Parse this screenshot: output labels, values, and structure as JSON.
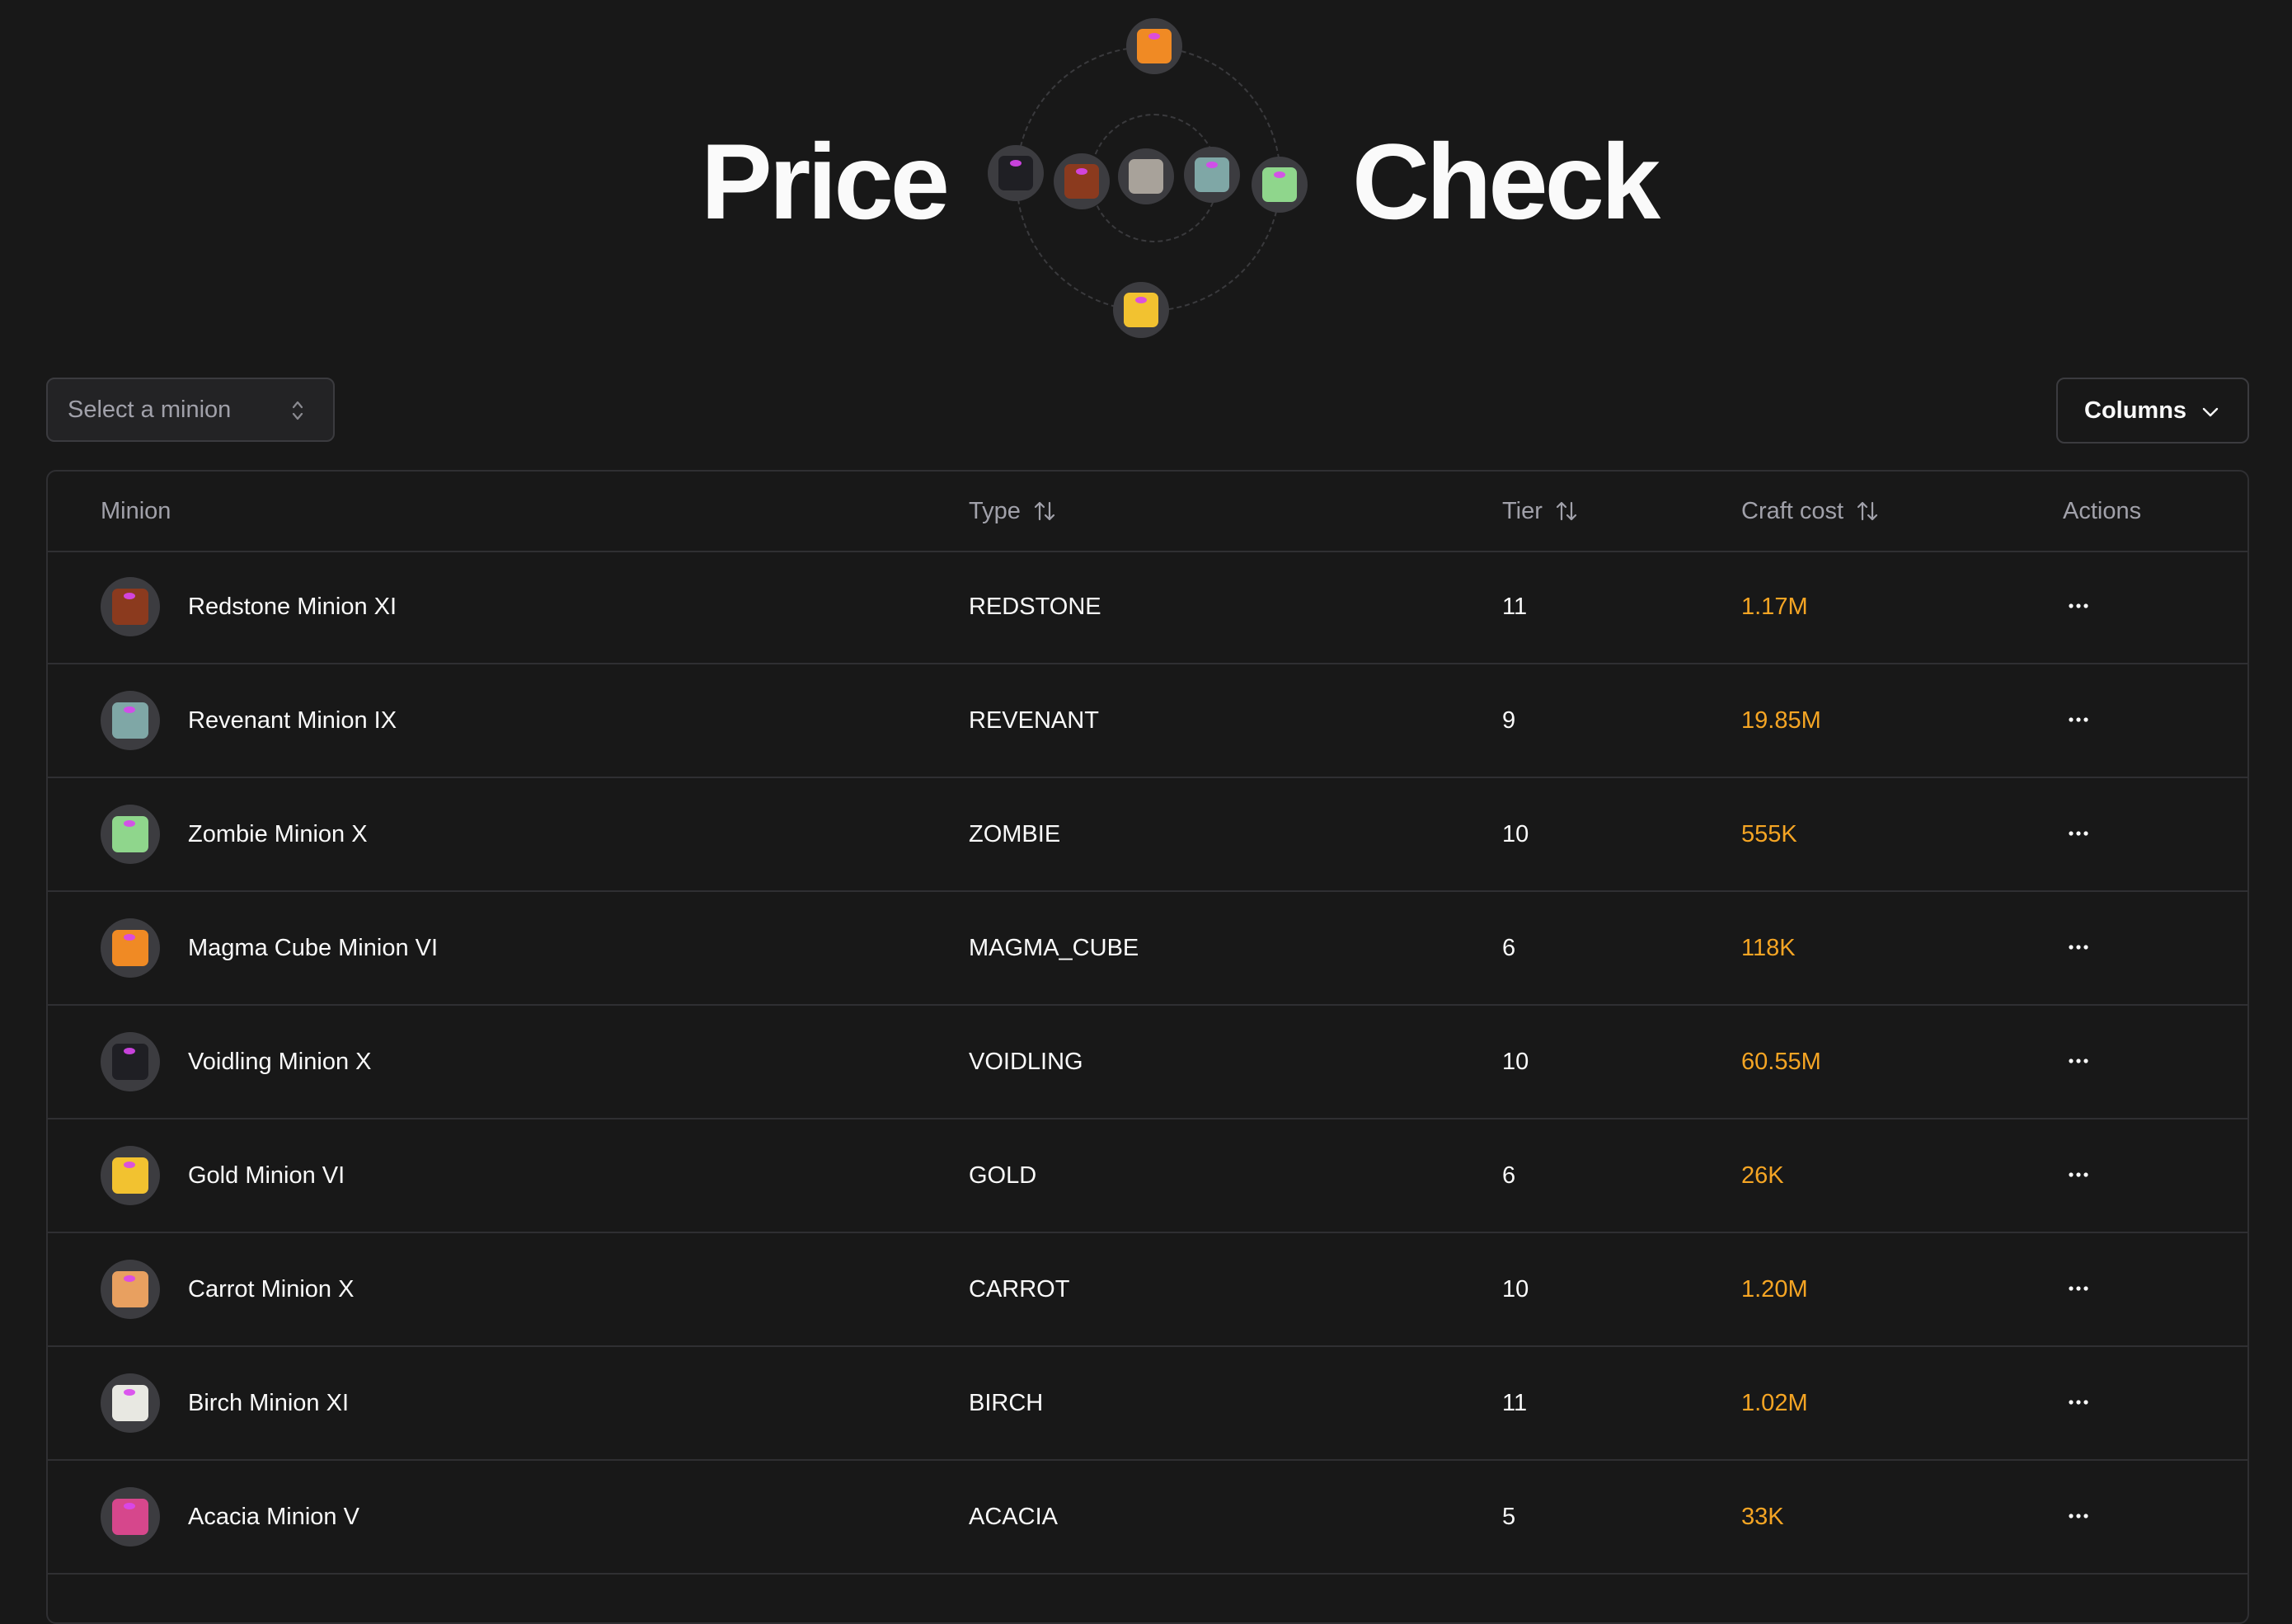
{
  "hero": {
    "word_left": "Price",
    "word_right": "Check",
    "orbit_icons": [
      "magma-cube-minion-icon",
      "voidling-minion-icon",
      "redstone-minion-icon",
      "stone-minion-icon",
      "revenant-minion-icon",
      "zombie-minion-icon",
      "gold-minion-icon"
    ]
  },
  "controls": {
    "select_placeholder": "Select a minion",
    "columns_label": "Columns"
  },
  "table": {
    "headers": {
      "minion": "Minion",
      "type": "Type",
      "tier": "Tier",
      "craft_cost": "Craft cost",
      "actions": "Actions"
    },
    "rows": [
      {
        "name": "Redstone Minion XI",
        "type": "REDSTONE",
        "tier": "11",
        "cost": "1.17M",
        "icon": "redstone-minion-icon",
        "color": "#8b3a1e"
      },
      {
        "name": "Revenant Minion IX",
        "type": "REVENANT",
        "tier": "9",
        "cost": "19.85M",
        "icon": "revenant-minion-icon",
        "color": "#7fa7a6"
      },
      {
        "name": "Zombie Minion X",
        "type": "ZOMBIE",
        "tier": "10",
        "cost": "555K",
        "icon": "zombie-minion-icon",
        "color": "#8fd68c"
      },
      {
        "name": "Magma Cube Minion VI",
        "type": "MAGMA_CUBE",
        "tier": "6",
        "cost": "118K",
        "icon": "magma-cube-minion-icon",
        "color": "#f08a24"
      },
      {
        "name": "Voidling Minion X",
        "type": "VOIDLING",
        "tier": "10",
        "cost": "60.55M",
        "icon": "voidling-minion-icon",
        "color": "#1f1f24"
      },
      {
        "name": "Gold Minion VI",
        "type": "GOLD",
        "tier": "6",
        "cost": "26K",
        "icon": "gold-minion-icon",
        "color": "#f2c230"
      },
      {
        "name": "Carrot Minion X",
        "type": "CARROT",
        "tier": "10",
        "cost": "1.20M",
        "icon": "carrot-minion-icon",
        "color": "#e8a060"
      },
      {
        "name": "Birch Minion XI",
        "type": "BIRCH",
        "tier": "11",
        "cost": "1.02M",
        "icon": "birch-minion-icon",
        "color": "#e8e8e2"
      },
      {
        "name": "Acacia Minion V",
        "type": "ACACIA",
        "tier": "5",
        "cost": "33K",
        "icon": "acacia-minion-icon",
        "color": "#d6478c"
      }
    ]
  },
  "colors": {
    "background": "#181818",
    "accent_cost": "#f5a524",
    "border": "#2f2f32"
  }
}
